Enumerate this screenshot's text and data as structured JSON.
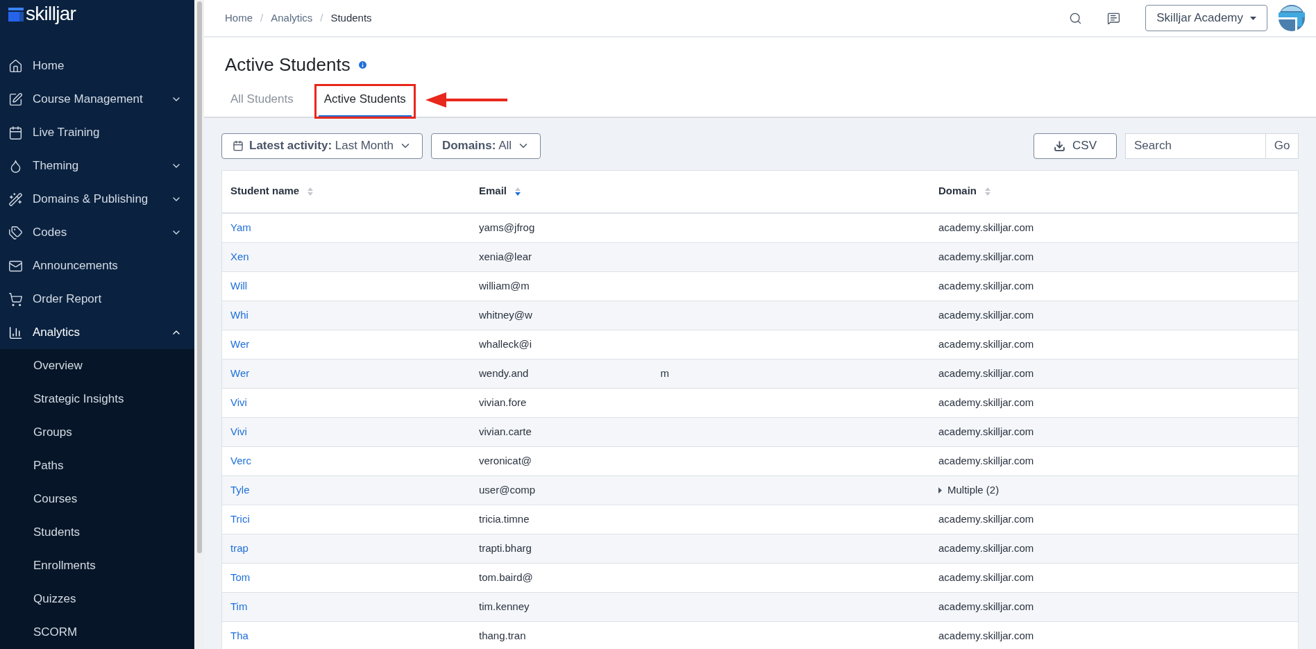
{
  "sidebar": {
    "logo": "skilljar",
    "items": [
      {
        "label": "Home"
      },
      {
        "label": "Course Management",
        "expanded": false
      },
      {
        "label": "Live Training"
      },
      {
        "label": "Theming",
        "expanded": false
      },
      {
        "label": "Domains & Publishing",
        "expanded": false
      },
      {
        "label": "Codes",
        "expanded": false
      },
      {
        "label": "Announcements"
      },
      {
        "label": "Order Report"
      },
      {
        "label": "Analytics",
        "expanded": true,
        "children": [
          {
            "label": "Overview"
          },
          {
            "label": "Strategic Insights"
          },
          {
            "label": "Groups"
          },
          {
            "label": "Paths"
          },
          {
            "label": "Courses"
          },
          {
            "label": "Students"
          },
          {
            "label": "Enrollments"
          },
          {
            "label": "Quizzes"
          },
          {
            "label": "SCORM"
          }
        ]
      }
    ]
  },
  "breadcrumbs": [
    {
      "label": "Home",
      "separator": "/"
    },
    {
      "label": "Analytics",
      "separator": "/"
    },
    {
      "label": "Students"
    }
  ],
  "account": {
    "label": "Skilljar Academy"
  },
  "page": {
    "title": "Active Students"
  },
  "tabs": [
    {
      "label": "All Students",
      "selected": false,
      "annotated": false
    },
    {
      "label": "Active Students",
      "selected": true,
      "annotated": true
    }
  ],
  "filters": [
    {
      "name": "Latest activity:",
      "value": "Last Month",
      "icon": true
    },
    {
      "name": "Domains:",
      "value": "All",
      "icon": false
    }
  ],
  "csv_button": "CSV",
  "search": {
    "placeholder": "Search",
    "button": "Go"
  },
  "table": {
    "columns": [
      {
        "label": "Student name",
        "sorted": false
      },
      {
        "label": "Email",
        "sorted": true
      },
      {
        "label": "Domain",
        "sorted": false
      }
    ],
    "rows": [
      {
        "name": "Yam",
        "email": "yams@jfrog",
        "domain": "academy.skilljar.com"
      },
      {
        "name": "Xen",
        "email": "xenia@lear",
        "domain": "academy.skilljar.com"
      },
      {
        "name": "Will",
        "email": "william@m",
        "domain": "academy.skilljar.com"
      },
      {
        "name": "Whi",
        "email": "whitney@w",
        "domain": "academy.skilljar.com"
      },
      {
        "name": "Wer",
        "email": "whalleck@i",
        "domain": "academy.skilljar.com"
      },
      {
        "name": "Wer",
        "email": "wendy.and",
        "email_end": "m",
        "domain": "academy.skilljar.com"
      },
      {
        "name": "Vivi",
        "email": "vivian.fore",
        "domain": "academy.skilljar.com"
      },
      {
        "name": "Vivi",
        "email": "vivian.carte",
        "domain": "academy.skilljar.com"
      },
      {
        "name": "Verc",
        "email": "veronicat@",
        "domain": "academy.skilljar.com"
      },
      {
        "name": "Tyle",
        "email": "user@comp",
        "domain": "Multiple (2)",
        "expandable": true
      },
      {
        "name": "Trici",
        "email": "tricia.timne",
        "domain": "academy.skilljar.com"
      },
      {
        "name": "trap",
        "email": "trapti.bharg",
        "domain": "academy.skilljar.com"
      },
      {
        "name": "Tom",
        "email": "tom.baird@",
        "domain": "academy.skilljar.com"
      },
      {
        "name": "Tim",
        "email": "tim.kenney",
        "domain": "academy.skilljar.com"
      },
      {
        "name": "Tha",
        "email": "thang.tran",
        "domain": "academy.skilljar.com"
      }
    ]
  }
}
